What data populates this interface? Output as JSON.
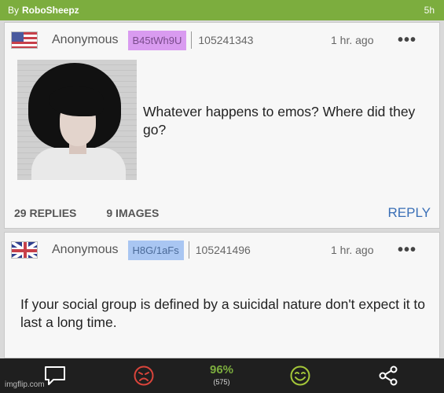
{
  "header": {
    "by_prefix": "By",
    "author": "RoboSheepz",
    "time": "5h"
  },
  "posts": [
    {
      "flag": "us-flag-icon",
      "name": "Anonymous",
      "poster_id": "B45tWh9U",
      "post_number": "105241343",
      "time_ago": "1 hr. ago",
      "text": "Whatever happens to emos? Where did they go?",
      "replies": "29 REPLIES",
      "images": "9 IMAGES",
      "reply_label": "REPLY"
    },
    {
      "flag": "uk-flag-icon",
      "name": "Anonymous",
      "poster_id": "H8G/1aFs",
      "post_number": "105241496",
      "time_ago": "1 hr. ago",
      "text": "If your social group is defined by a suicidal nature don't expect it to last a long time."
    }
  ],
  "footer": {
    "score_pct": "96%",
    "vote_count": "(575)",
    "watermark": "imgflip.com"
  },
  "colors": {
    "brand_green": "#7cad3e",
    "downvote_red": "#d9443b",
    "upvote_green": "#a4c639",
    "reply_blue": "#3a6fb6"
  }
}
